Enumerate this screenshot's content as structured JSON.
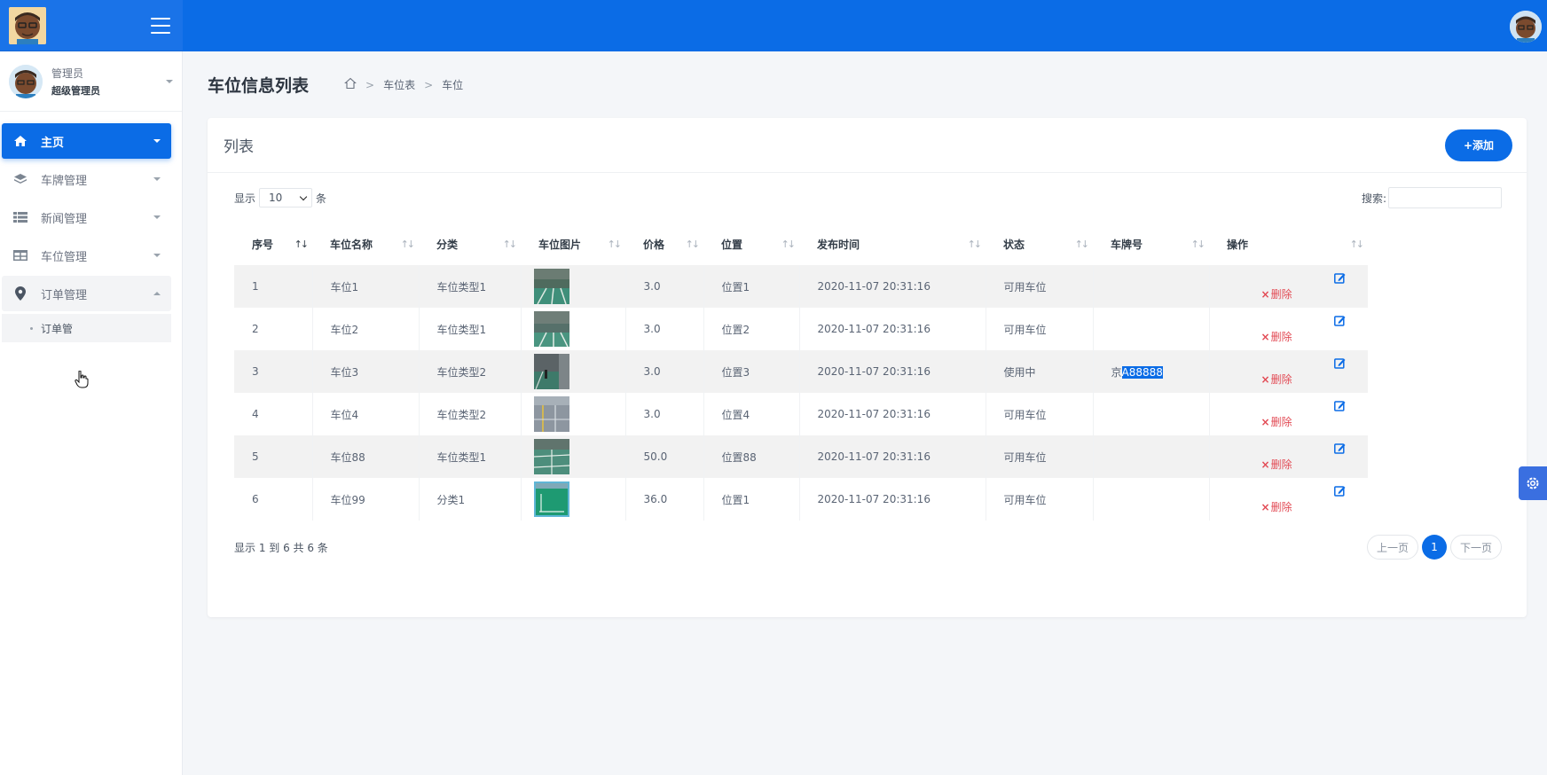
{
  "sidebar": {
    "user": {
      "name": "管理员",
      "role": "超级管理员"
    },
    "items": [
      {
        "label": "主页",
        "icon": "home-icon"
      },
      {
        "label": "车牌管理",
        "icon": "layers-icon"
      },
      {
        "label": "新闻管理",
        "icon": "list-icon"
      },
      {
        "label": "车位管理",
        "icon": "table-icon"
      },
      {
        "label": "订单管理",
        "icon": "map-marker-icon"
      }
    ],
    "sub_items": [
      {
        "label": "订单管"
      }
    ]
  },
  "header": {
    "page_title": "车位信息列表",
    "breadcrumbs": [
      "车位表",
      "车位"
    ]
  },
  "card": {
    "title": "列表",
    "add_label": "+添加"
  },
  "controls": {
    "show_prefix": "显示",
    "page_length": "10",
    "show_suffix": "条",
    "search_label": "搜索:",
    "search_value": ""
  },
  "table": {
    "columns": [
      "序号",
      "车位名称",
      "分类",
      "车位图片",
      "价格",
      "位置",
      "发布时间",
      "状态",
      "车牌号",
      "操作"
    ],
    "delete_label": "删除",
    "rows": [
      {
        "id": "1",
        "name": "车位1",
        "category": "车位类型1",
        "price": "3.0",
        "location": "位置1",
        "time": "2020-11-07 20:31:16",
        "status": "可用车位",
        "plate_prefix": "",
        "plate_rest": ""
      },
      {
        "id": "2",
        "name": "车位2",
        "category": "车位类型1",
        "price": "3.0",
        "location": "位置2",
        "time": "2020-11-07 20:31:16",
        "status": "可用车位",
        "plate_prefix": "",
        "plate_rest": ""
      },
      {
        "id": "3",
        "name": "车位3",
        "category": "车位类型2",
        "price": "3.0",
        "location": "位置3",
        "time": "2020-11-07 20:31:16",
        "status": "使用中",
        "plate_prefix": "京",
        "plate_rest": "A88888"
      },
      {
        "id": "4",
        "name": "车位4",
        "category": "车位类型2",
        "price": "3.0",
        "location": "位置4",
        "time": "2020-11-07 20:31:16",
        "status": "可用车位",
        "plate_prefix": "",
        "plate_rest": ""
      },
      {
        "id": "5",
        "name": "车位88",
        "category": "车位类型1",
        "price": "50.0",
        "location": "位置88",
        "time": "2020-11-07 20:31:16",
        "status": "可用车位",
        "plate_prefix": "",
        "plate_rest": ""
      },
      {
        "id": "6",
        "name": "车位99",
        "category": "分类1",
        "price": "36.0",
        "location": "位置1",
        "time": "2020-11-07 20:31:16",
        "status": "可用车位",
        "plate_prefix": "",
        "plate_rest": ""
      }
    ]
  },
  "footer": {
    "info": "显示 1 到 6 共 6 条",
    "prev": "上一页",
    "current_page": "1",
    "next": "下一页"
  },
  "colors": {
    "primary": "#0b6ce6",
    "danger": "#e24b55",
    "stripe": "#f2f2f2"
  }
}
